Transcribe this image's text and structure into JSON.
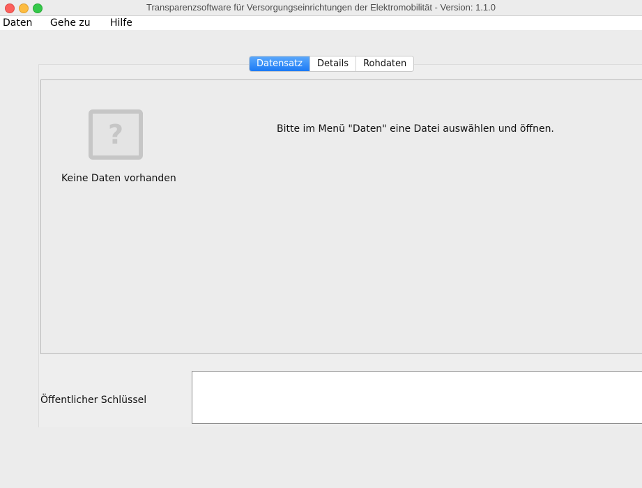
{
  "window": {
    "title": "Transparenzsoftware für Versorgungseinrichtungen der Elektromobilität - Version: 1.1.0"
  },
  "menubar": {
    "items": [
      "Daten",
      "Gehe zu",
      "Hilfe"
    ]
  },
  "tabs": {
    "items": [
      "Datensatz",
      "Details",
      "Rohdaten"
    ],
    "selected": "Datensatz"
  },
  "main": {
    "icon": "question-mark-icon",
    "no_data_label": "Keine Daten vorhanden",
    "hint": "Bitte im Menü \"Daten\" eine Datei auswählen und öffnen."
  },
  "public_key": {
    "label": "Öffentlicher Schlüssel",
    "value": ""
  },
  "colors": {
    "tab_selected": "#1b7af5",
    "close": "#fc605c",
    "minimize": "#fdbc40",
    "zoom": "#34c84a"
  }
}
